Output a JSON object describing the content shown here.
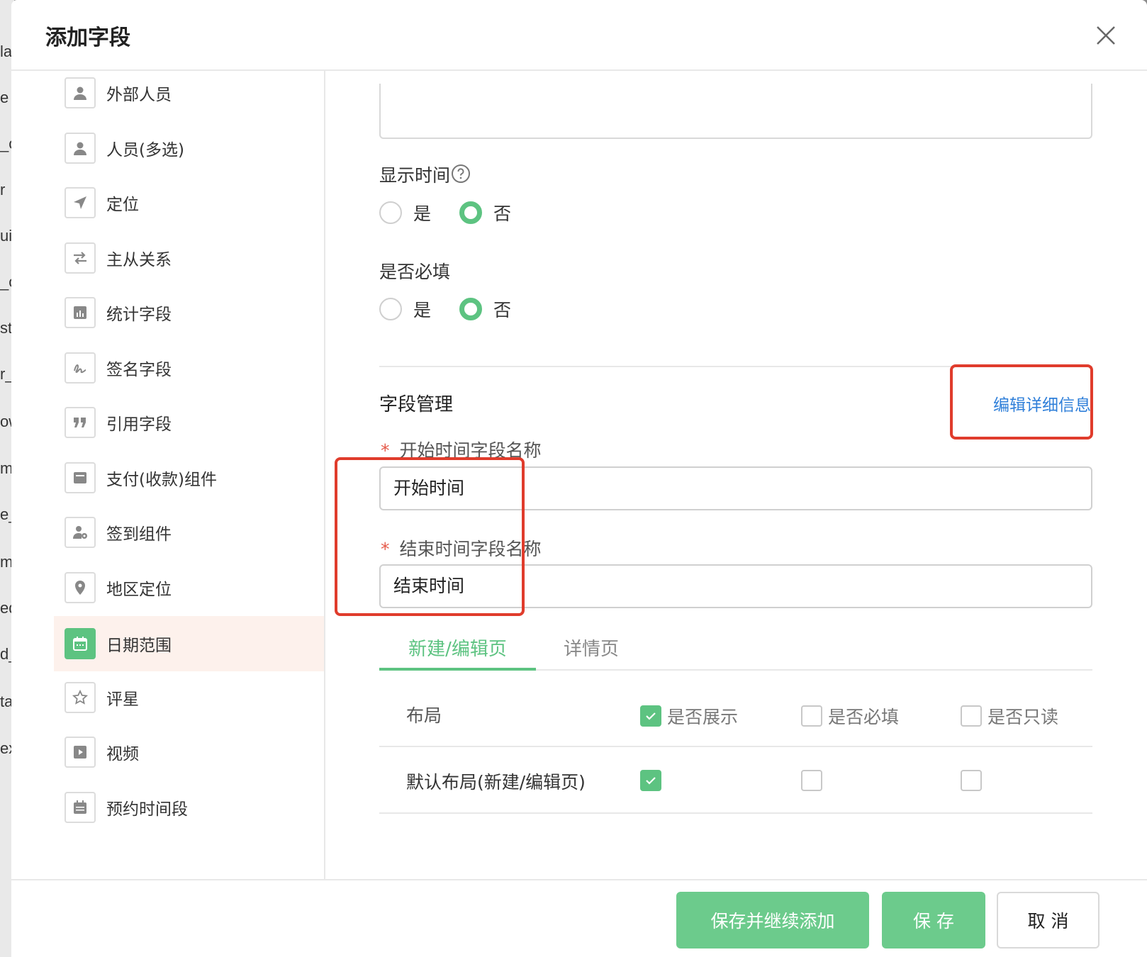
{
  "background_fragments": [
    "la",
    "e",
    "_o",
    "r",
    "ui",
    "_o",
    "st",
    "r_",
    "ow",
    "m",
    "e_",
    "m",
    "ed",
    "d_",
    "ta",
    "ex"
  ],
  "dialog": {
    "title": "添加字段"
  },
  "sidebar": {
    "items": [
      {
        "label": "外部人员",
        "icon": "person-icon"
      },
      {
        "label": "人员(多选)",
        "icon": "person-icon"
      },
      {
        "label": "定位",
        "icon": "location-arrow-icon"
      },
      {
        "label": "主从关系",
        "icon": "swap-arrows-icon"
      },
      {
        "label": "统计字段",
        "icon": "bar-chart-icon"
      },
      {
        "label": "签名字段",
        "icon": "signature-icon"
      },
      {
        "label": "引用字段",
        "icon": "quote-icon"
      },
      {
        "label": "支付(收款)组件",
        "icon": "card-icon"
      },
      {
        "label": "签到组件",
        "icon": "check-in-person-icon"
      },
      {
        "label": "地区定位",
        "icon": "map-pin-icon"
      },
      {
        "label": "日期范围",
        "icon": "calendar-icon",
        "active": true
      },
      {
        "label": "评星",
        "icon": "star-icon"
      },
      {
        "label": "视频",
        "icon": "video-play-icon"
      },
      {
        "label": "预约时间段",
        "icon": "calendar-icon"
      }
    ]
  },
  "form": {
    "show_time": {
      "label": "显示时间",
      "options": [
        "是",
        "否"
      ],
      "selected": "否"
    },
    "required": {
      "label": "是否必填",
      "options": [
        "是",
        "否"
      ],
      "selected": "否"
    },
    "field_management": {
      "title": "字段管理",
      "edit_link": "编辑详细信息"
    },
    "start_field": {
      "label": "开始时间字段名称",
      "required_mark": "*",
      "value": "开始时间"
    },
    "end_field": {
      "label": "结束时间字段名称",
      "required_mark": "*",
      "value": "结束时间"
    },
    "tabs": [
      {
        "label": "新建/编辑页",
        "active": true
      },
      {
        "label": "详情页",
        "active": false
      }
    ],
    "permissions": {
      "header": {
        "label": "布局",
        "columns": [
          {
            "label": "是否展示",
            "checked": true
          },
          {
            "label": "是否必填",
            "checked": false
          },
          {
            "label": "是否只读",
            "checked": false
          }
        ]
      },
      "rows": [
        {
          "label": "默认布局(新建/编辑页)",
          "values": [
            true,
            false,
            false
          ]
        }
      ]
    }
  },
  "footer": {
    "save_and_continue": "保存并继续添加",
    "save": "保 存",
    "cancel": "取 消"
  },
  "colors": {
    "accent_green": "#5dc381",
    "link_blue": "#2f7fd9",
    "annotation_red": "#e03c2c",
    "active_item_bg": "#fdf1ec"
  }
}
